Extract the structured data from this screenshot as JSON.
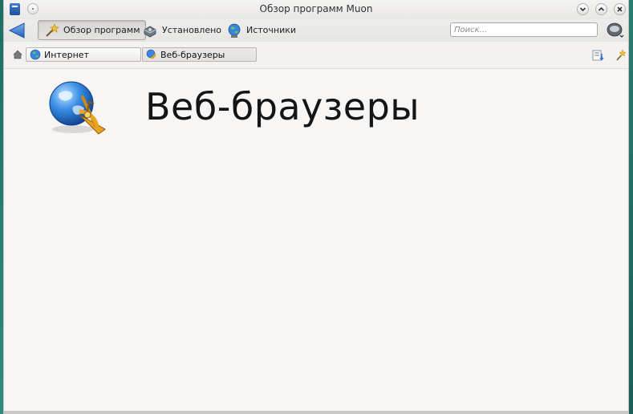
{
  "window": {
    "title": "Обзор программ Muon",
    "icons": {
      "app": "muon-app-icon",
      "sticky": "sticky-pin-icon",
      "minimize": "minimize-icon",
      "maximize": "maximize-icon",
      "close": "close-icon"
    }
  },
  "toolbar": {
    "back_icon": "arrow-left-icon",
    "items": [
      {
        "label": "Обзор программ",
        "icon": "wand-icon",
        "active": true
      },
      {
        "label": "Установлено",
        "icon": "drive-icon",
        "active": false
      },
      {
        "label": "Источники",
        "icon": "globe-icon",
        "active": false
      }
    ],
    "search": {
      "placeholder": "Поиск...",
      "value": ""
    },
    "menu_icon": "menu-drive-icon"
  },
  "breadcrumb": {
    "home_icon": "home-icon",
    "items": [
      {
        "label": "Интернет",
        "icon": "globe-icon"
      },
      {
        "label": "Веб-браузеры",
        "icon": "browser-icon"
      }
    ],
    "side_icons": [
      "download-list-icon",
      "wand-small-icon"
    ]
  },
  "content": {
    "category_title": "Веб-браузеры",
    "category_icon": "web-browser-sextant-icon"
  },
  "colors": {
    "window_bg": "#f7f6f5",
    "toolbar_bg": "#e9e8e6",
    "accent_blue": "#3a86de",
    "desktop_teal": "#2e8c7d"
  }
}
